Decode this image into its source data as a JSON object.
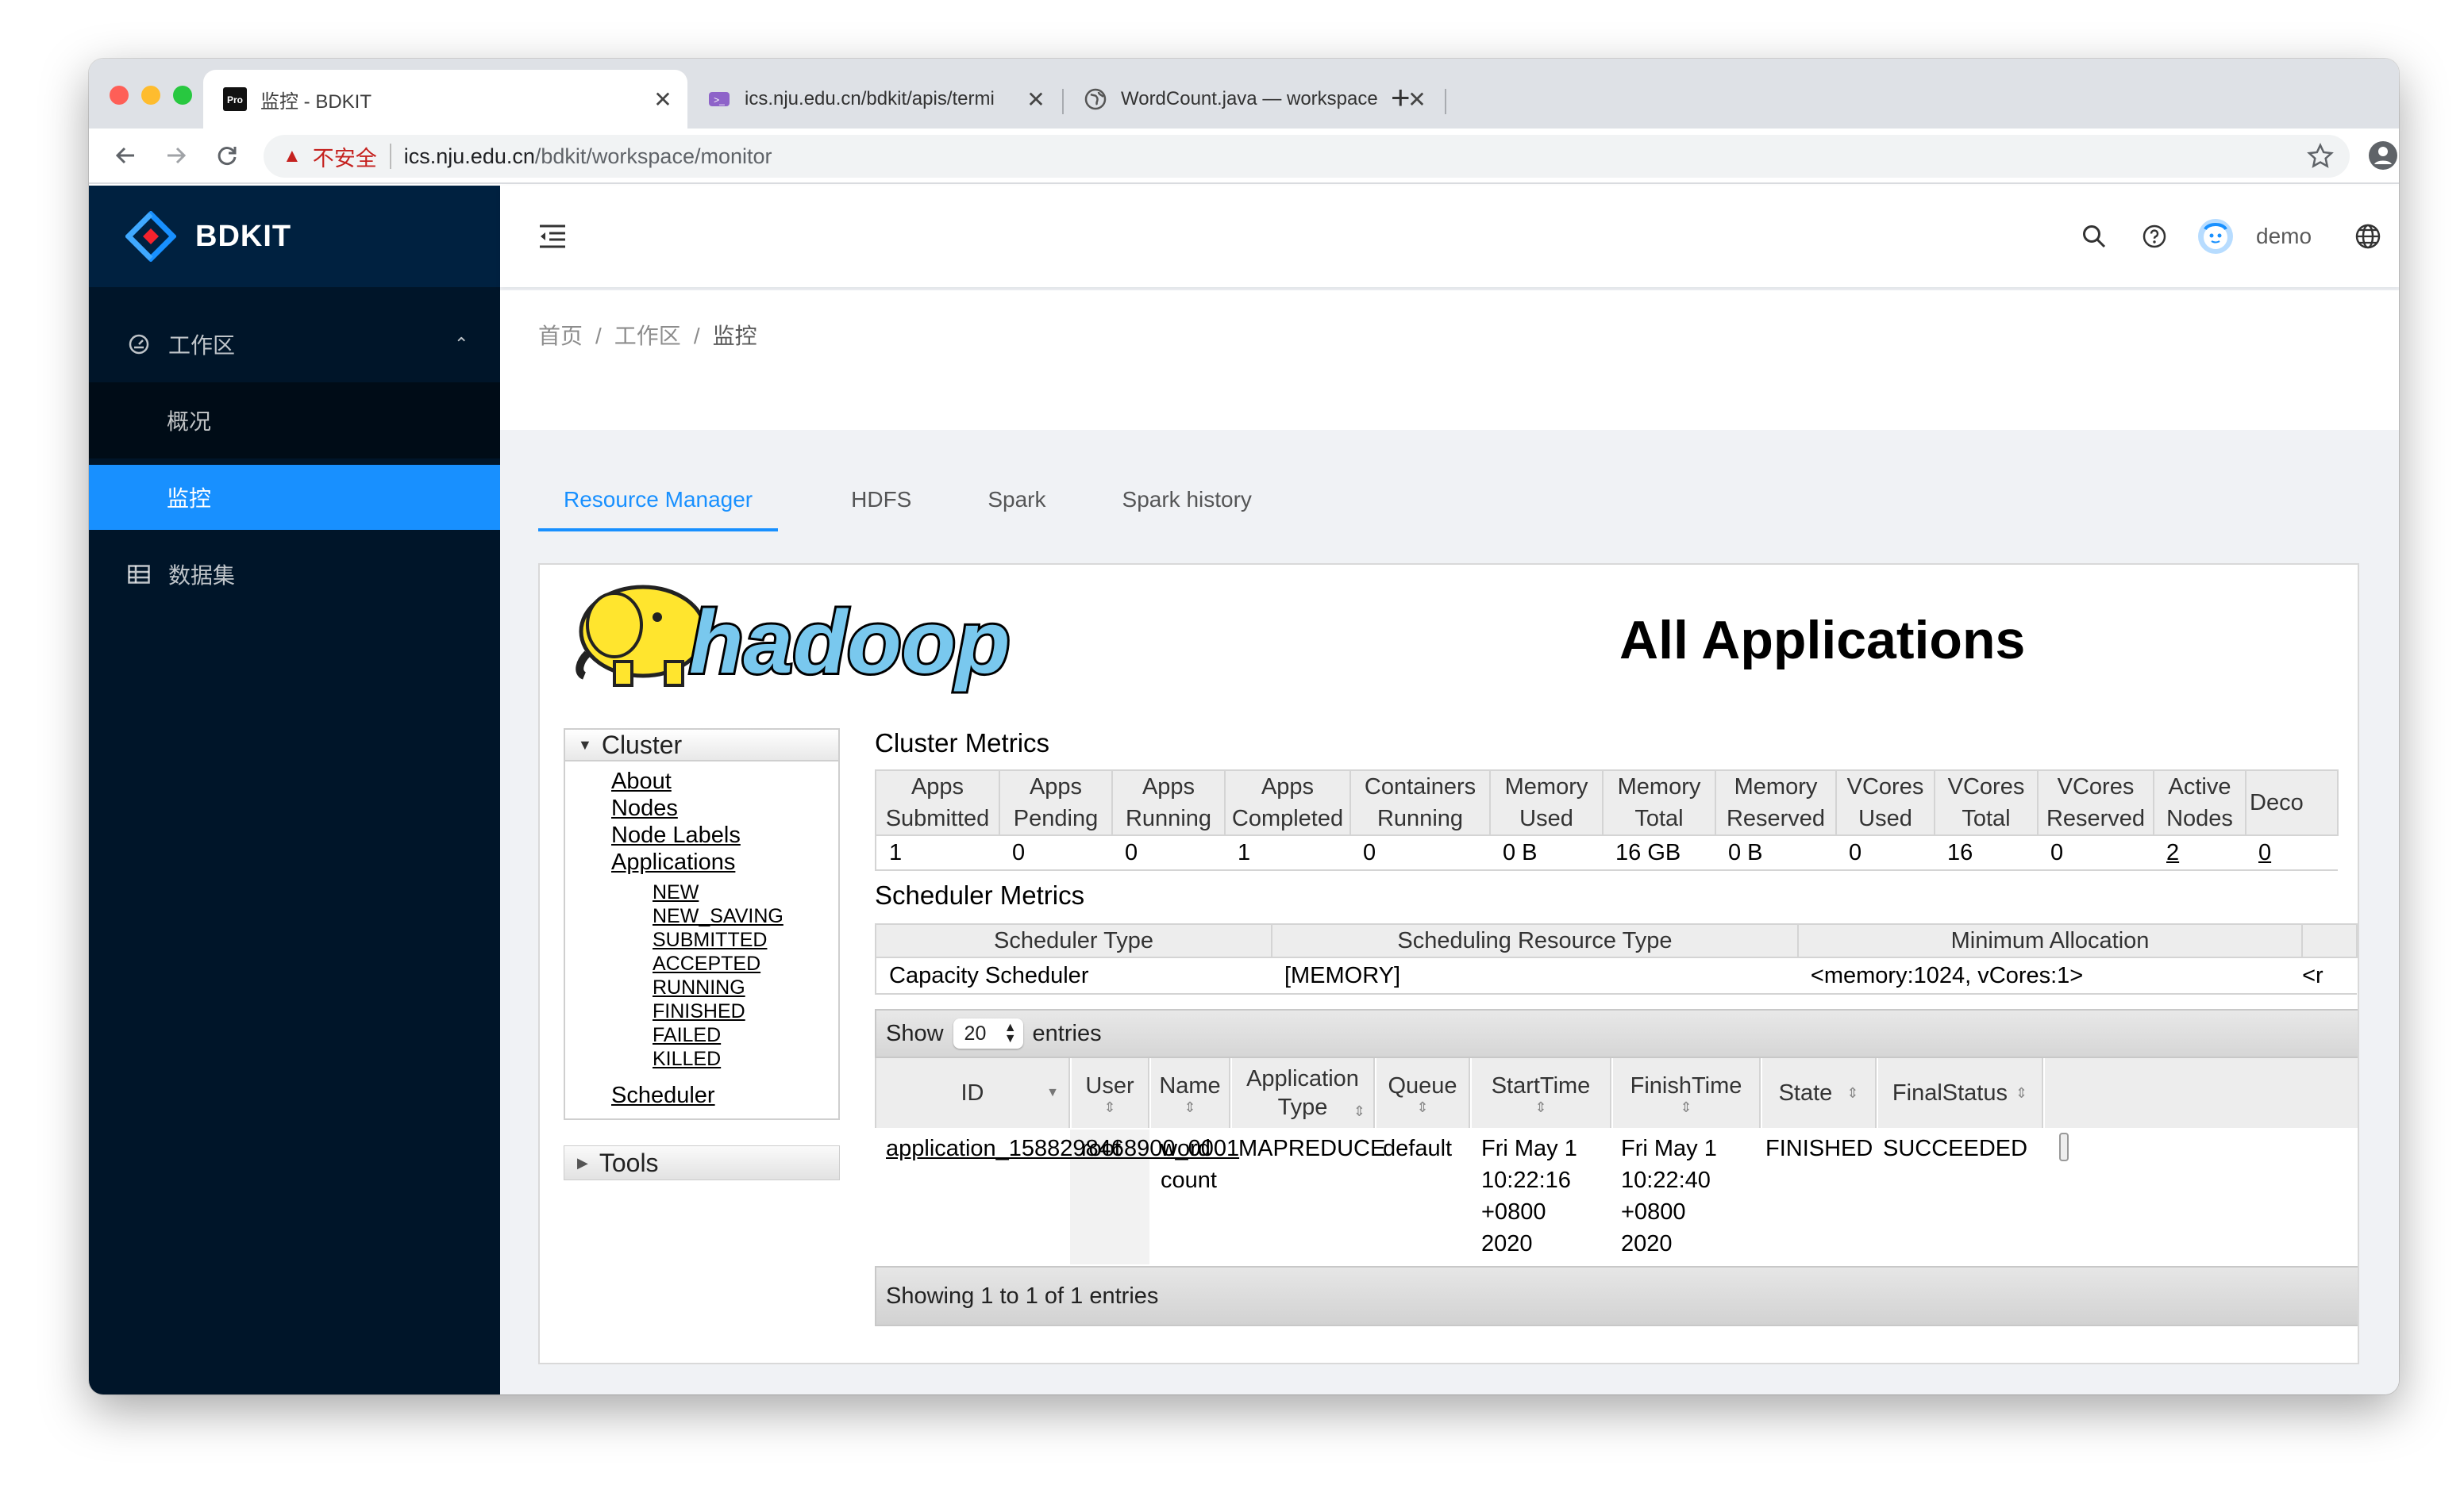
{
  "browser": {
    "tabs": [
      {
        "title": "监控 - BDKIT",
        "favicon": "pro-icon",
        "active": true
      },
      {
        "title": "ics.nju.edu.cn/bdkit/apis/termi",
        "favicon": "terminal-icon",
        "active": false
      },
      {
        "title": "WordCount.java — workspace",
        "favicon": "globe-icon",
        "active": false
      }
    ],
    "security_label": "不安全",
    "url_host": "ics.nju.edu.cn",
    "url_path": "/bdkit/workspace/monitor"
  },
  "sidebar": {
    "brand": "BDKIT",
    "items": [
      {
        "label": "工作区",
        "icon": "dashboard-icon"
      },
      {
        "label": "概况"
      },
      {
        "label": "监控"
      },
      {
        "label": "数据集",
        "icon": "table-icon"
      }
    ]
  },
  "header": {
    "user": "demo"
  },
  "breadcrumb": [
    "首页",
    "工作区",
    "监控"
  ],
  "tabs": [
    "Resource Manager",
    "HDFS",
    "Spark",
    "Spark history"
  ],
  "hadoop": {
    "logo_text": "hadoop",
    "title": "All Applications",
    "nav": {
      "cluster": "Cluster",
      "links": [
        "About",
        "Nodes",
        "Node Labels",
        "Applications"
      ],
      "states": [
        "NEW",
        "NEW_SAVING",
        "SUBMITTED",
        "ACCEPTED",
        "RUNNING",
        "FINISHED",
        "FAILED",
        "KILLED"
      ],
      "scheduler": "Scheduler",
      "tools": "Tools"
    },
    "cluster_metrics": {
      "title": "Cluster Metrics",
      "headers": [
        [
          "Apps",
          "Submitted"
        ],
        [
          "Apps",
          "Pending"
        ],
        [
          "Apps",
          "Running"
        ],
        [
          "Apps",
          "Completed"
        ],
        [
          "Containers",
          "Running"
        ],
        [
          "Memory",
          "Used"
        ],
        [
          "Memory",
          "Total"
        ],
        [
          "Memory",
          "Reserved"
        ],
        [
          "VCores",
          "Used"
        ],
        [
          "VCores",
          "Total"
        ],
        [
          "VCores",
          "Reserved"
        ],
        [
          "Active",
          "Nodes"
        ],
        [
          "Deco",
          ""
        ]
      ],
      "values": [
        "1",
        "0",
        "0",
        "1",
        "0",
        "0 B",
        "16 GB",
        "0 B",
        "0",
        "16",
        "0",
        "2",
        "0"
      ]
    },
    "scheduler_metrics": {
      "title": "Scheduler Metrics",
      "headers": [
        "Scheduler Type",
        "Scheduling Resource Type",
        "Minimum Allocation"
      ],
      "values": [
        "Capacity Scheduler",
        "[MEMORY]",
        "<memory:1024, vCores:1>",
        "<r"
      ]
    },
    "show": {
      "prefix": "Show",
      "value": "20",
      "suffix": "entries"
    },
    "apps_headers": {
      "id": "ID",
      "user": "User",
      "name": "Name",
      "type": "Application Type",
      "queue": "Queue",
      "start": "StartTime",
      "finish": "FinishTime",
      "state": "State",
      "final": "FinalStatus"
    },
    "apps": [
      {
        "id": "application_1588298468900_0001",
        "user": "root",
        "name": "word count",
        "type": "MAPREDUCE",
        "queue": "default",
        "start": [
          "Fri May 1",
          "10:22:16",
          "+0800",
          "2020"
        ],
        "finish": [
          "Fri May 1",
          "10:22:40",
          "+0800",
          "2020"
        ],
        "state": "FINISHED",
        "final": "SUCCEEDED"
      }
    ],
    "showing": "Showing 1 to 1 of 1 entries"
  }
}
